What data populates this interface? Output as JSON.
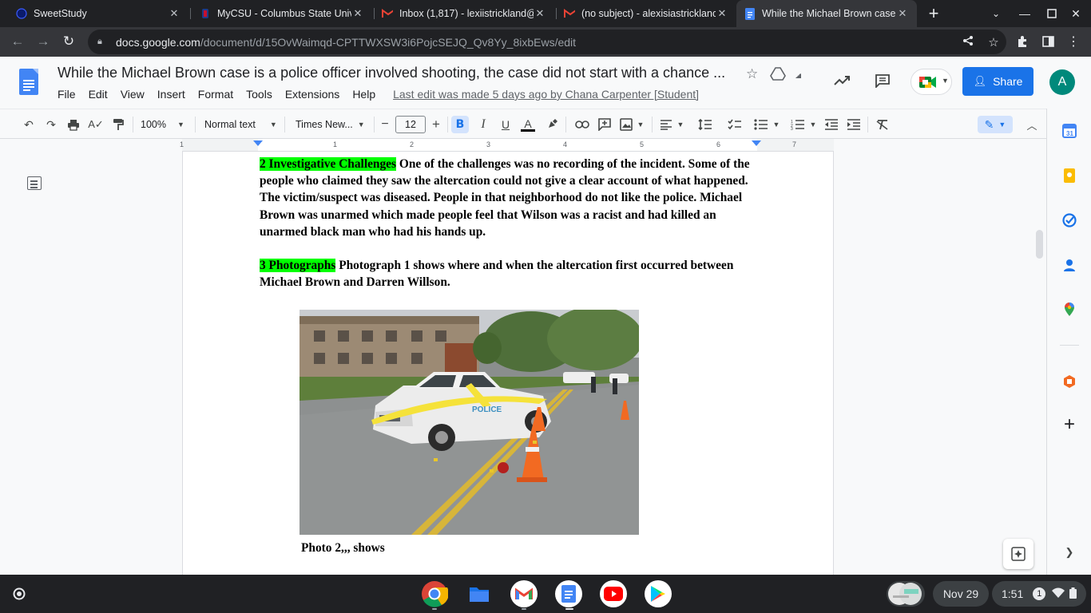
{
  "browser": {
    "tabs": [
      {
        "title": "SweetStudy",
        "icon": "sweetstudy-icon",
        "active": false
      },
      {
        "title": "MyCSU - Columbus State Univ",
        "icon": "csu-icon",
        "active": false
      },
      {
        "title": "Inbox (1,817) - lexiistrickland@",
        "icon": "gmail-icon",
        "active": false
      },
      {
        "title": "(no subject) - alexisiastricklanc",
        "icon": "gmail-icon",
        "active": false
      },
      {
        "title": "While the Michael Brown case",
        "icon": "docs-icon",
        "active": true
      }
    ],
    "url_host": "docs.google.com",
    "url_path": "/document/d/15OvWaimqd-CPTTWXSW3i6PojcSEJQ_Qv8Yy_8ixbEws/edit"
  },
  "doc": {
    "title": "While the Michael Brown case is a police officer involved shooting, the case did not start with a chance ...",
    "menu": [
      "File",
      "Edit",
      "View",
      "Insert",
      "Format",
      "Tools",
      "Extensions",
      "Help"
    ],
    "last_edit": "Last edit was made 5 days ago by Chana Carpenter [Student]",
    "share_label": "Share",
    "avatar_letter": "A"
  },
  "format_toolbar": {
    "zoom": "100%",
    "style": "Normal text",
    "font": "Times New...",
    "font_size": "12"
  },
  "ruler": {
    "numbers": [
      "1",
      "1",
      "2",
      "3",
      "4",
      "5",
      "6",
      "7"
    ]
  },
  "content": {
    "p1_highlight": "2 Investigative Challenges",
    "p1_text": " One of the challenges was no recording of the incident. Some of the people who claimed they saw the altercation could not give a clear account of what happened.  The victim/suspect was diseased. People in that neighborhood do not like the police. Michael Brown was unarmed which made people feel that Wilson was a racist and had killed an unarmed black man who had his hands up.",
    "p2_highlight": "3 Photographs",
    "p2_text": " Photograph 1 shows where and when the altercation first occurred between Michael Brown and Darren Willson.",
    "photo_vehicle_text": "POLICE",
    "caption": "Photo 2,,, shows"
  },
  "shelf": {
    "date": "Nov 29",
    "time": "1:51",
    "notification_count": "1",
    "apps": [
      "chrome-icon",
      "files-icon",
      "gmail-icon",
      "docs-icon",
      "youtube-icon",
      "play-store-icon"
    ]
  },
  "colors": {
    "highlight": "#00ff00",
    "accent": "#1a73e8",
    "tabbar": "#202124",
    "toolbar": "#35363a"
  }
}
